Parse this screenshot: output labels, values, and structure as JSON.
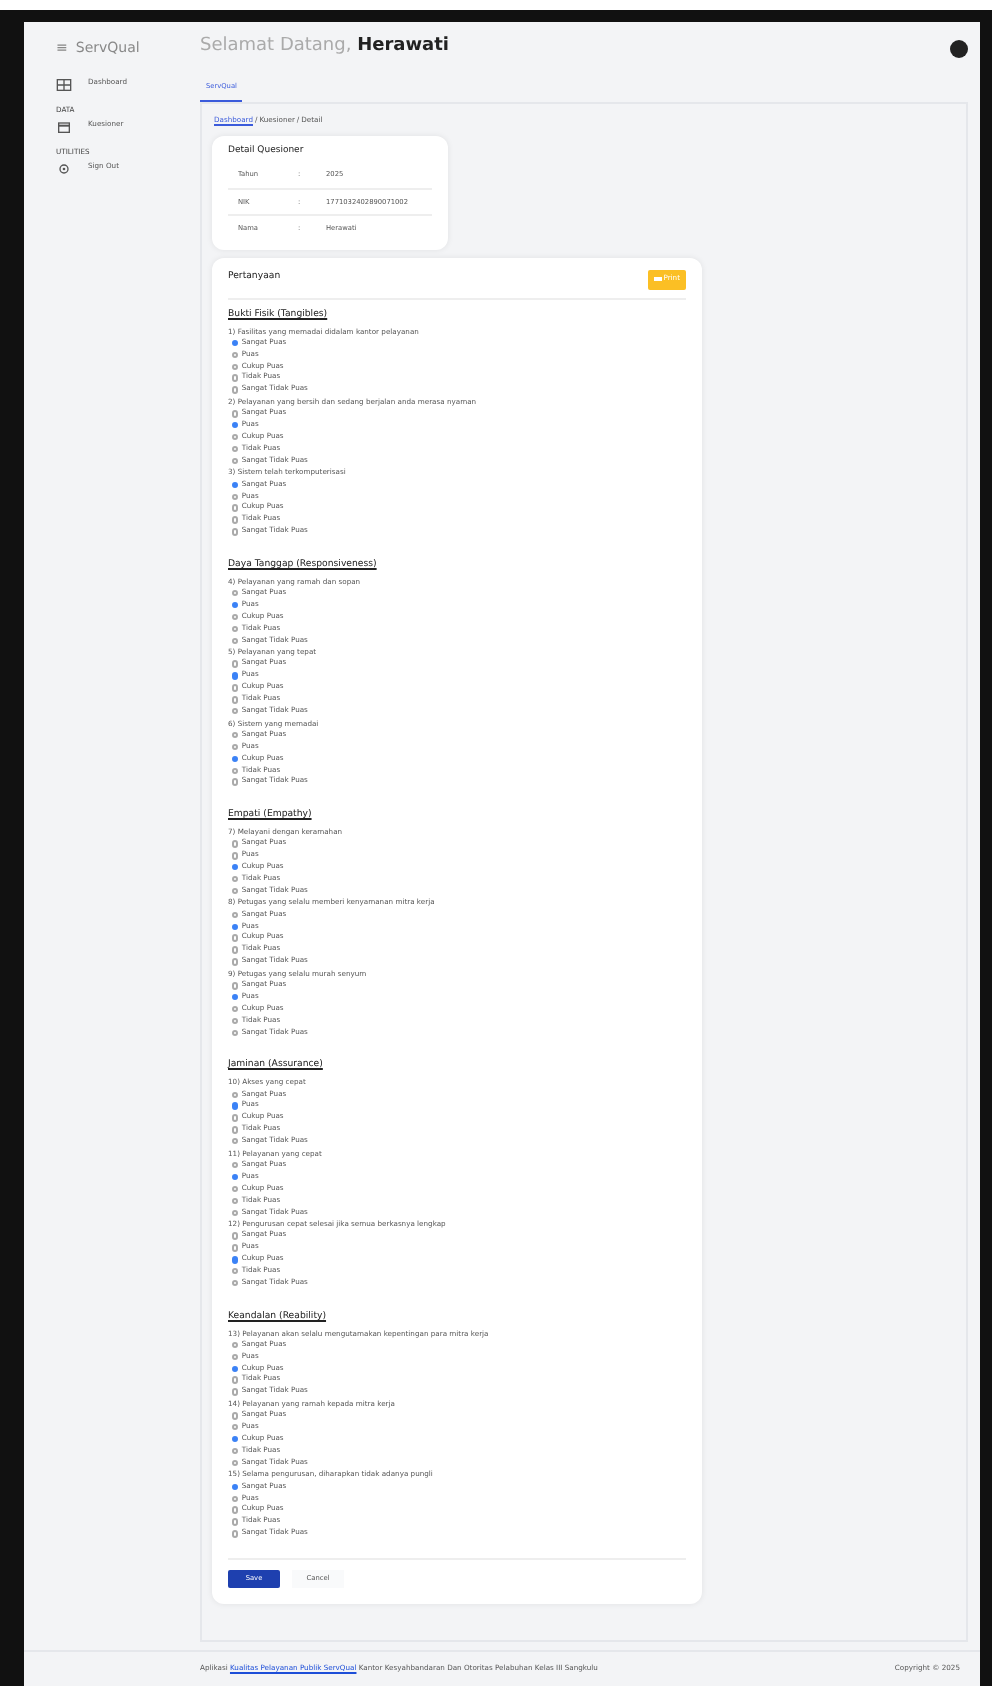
{
  "menu_glyph": "≡",
  "brand": "ServQual",
  "greeting": {
    "text": "Selamat Datang, **Herawati**"
  },
  "sidebar": [
    {
      "kind": "item",
      "label": "Dashboard"
    },
    {
      "kind": "heading",
      "label": "DATA"
    },
    {
      "kind": "item",
      "label": "Kuesioner"
    },
    {
      "kind": "heading",
      "label": "UTILITIES"
    },
    {
      "kind": "item",
      "label": "Sign Out"
    }
  ],
  "tab": {
    "label": "ServQual",
    "selected": true
  },
  "breadcrumb": [
    {
      "label": "Dashboard",
      "link": true
    },
    {
      "separator": "/",
      "label": "Kuesioner",
      "link": false
    },
    {
      "separator": "/",
      "label": "Detail",
      "link": false
    }
  ],
  "detail": {
    "title": "Detail Quesioner",
    "rows": [
      {
        "label": "Tahun",
        "sep": ":",
        "value": "2025"
      },
      {
        "label": "NIK",
        "sep": ":",
        "value": "1771032402890071002"
      },
      {
        "label": "Nama",
        "sep": ":",
        "value": "Herawati"
      }
    ]
  },
  "questions_card": {
    "title": "Pertanyaan",
    "print_button": "Print",
    "sections": [
      {
        "title": "Bukti Fisik (Tangibles)",
        "questions": [
          {
            "text": "1) Fasilitas yang memadai didalam kantor pelayanan",
            "options": [
              {
                "label": "Sangat Puas",
                "selected": true
              },
              {
                "label": "Puas",
                "selected": false
              },
              {
                "label": "Cukup Puas",
                "selected": false
              },
              {
                "label": "Tidak Puas",
                "selected": false
              },
              {
                "label": "Sangat Tidak Puas",
                "selected": false
              }
            ]
          },
          {
            "text": "2) Pelayanan yang bersih dan sedang berjalan anda merasa nyaman",
            "options": [
              {
                "label": "Sangat Puas",
                "selected": false
              },
              {
                "label": "Puas",
                "selected": true
              },
              {
                "label": "Cukup Puas",
                "selected": false
              },
              {
                "label": "Tidak Puas",
                "selected": false
              },
              {
                "label": "Sangat Tidak Puas",
                "selected": false
              }
            ]
          },
          {
            "text": "3) Sistem telah terkomputerisasi",
            "options": [
              {
                "label": "Sangat Puas",
                "selected": true
              },
              {
                "label": "Puas",
                "selected": false
              },
              {
                "label": "Cukup Puas",
                "selected": false
              },
              {
                "label": "Tidak Puas",
                "selected": false
              },
              {
                "label": "Sangat Tidak Puas",
                "selected": false
              }
            ]
          }
        ]
      },
      {
        "title": "Daya Tanggap (Responsiveness)",
        "questions": [
          {
            "text": "4) Pelayanan yang ramah dan sopan",
            "options": [
              {
                "label": "Sangat Puas",
                "selected": false
              },
              {
                "label": "Puas",
                "selected": true
              },
              {
                "label": "Cukup Puas",
                "selected": false
              },
              {
                "label": "Tidak Puas",
                "selected": false
              },
              {
                "label": "Sangat Tidak Puas",
                "selected": false
              }
            ]
          },
          {
            "text": "5) Pelayanan yang tepat",
            "options": [
              {
                "label": "Sangat Puas",
                "selected": false
              },
              {
                "label": "Puas",
                "selected": true
              },
              {
                "label": "Cukup Puas",
                "selected": false
              },
              {
                "label": "Tidak Puas",
                "selected": false
              },
              {
                "label": "Sangat Tidak Puas",
                "selected": false
              }
            ]
          },
          {
            "text": "6) Sistem yang memadai",
            "options": [
              {
                "label": "Sangat Puas",
                "selected": false
              },
              {
                "label": "Puas",
                "selected": false
              },
              {
                "label": "Cukup Puas",
                "selected": true
              },
              {
                "label": "Tidak Puas",
                "selected": false
              },
              {
                "label": "Sangat Tidak Puas",
                "selected": false
              }
            ]
          }
        ]
      },
      {
        "title": "Empati (Empathy)",
        "questions": [
          {
            "text": "7) Melayani dengan keramahan",
            "options": [
              {
                "label": "Sangat Puas",
                "selected": false
              },
              {
                "label": "Puas",
                "selected": false
              },
              {
                "label": "Cukup Puas",
                "selected": true
              },
              {
                "label": "Tidak Puas",
                "selected": false
              },
              {
                "label": "Sangat Tidak Puas",
                "selected": false
              }
            ]
          },
          {
            "text": "8) Petugas yang selalu memberi kenyamanan mitra kerja",
            "options": [
              {
                "label": "Sangat Puas",
                "selected": false
              },
              {
                "label": "Puas",
                "selected": true
              },
              {
                "label": "Cukup Puas",
                "selected": false
              },
              {
                "label": "Tidak Puas",
                "selected": false
              },
              {
                "label": "Sangat Tidak Puas",
                "selected": false
              }
            ]
          },
          {
            "text": "9) Petugas yang selalu murah senyum",
            "options": [
              {
                "label": "Sangat Puas",
                "selected": false
              },
              {
                "label": "Puas",
                "selected": true
              },
              {
                "label": "Cukup Puas",
                "selected": false
              },
              {
                "label": "Tidak Puas",
                "selected": false
              },
              {
                "label": "Sangat Tidak Puas",
                "selected": false
              }
            ]
          }
        ]
      },
      {
        "title": "Jaminan (Assurance)",
        "questions": [
          {
            "text": "10) Akses yang cepat",
            "options": [
              {
                "label": "Sangat Puas",
                "selected": false
              },
              {
                "label": "Puas",
                "selected": true
              },
              {
                "label": "Cukup Puas",
                "selected": false
              },
              {
                "label": "Tidak Puas",
                "selected": false
              },
              {
                "label": "Sangat Tidak Puas",
                "selected": false
              }
            ]
          },
          {
            "text": "11) Pelayanan yang cepat",
            "options": [
              {
                "label": "Sangat Puas",
                "selected": false
              },
              {
                "label": "Puas",
                "selected": true
              },
              {
                "label": "Cukup Puas",
                "selected": false
              },
              {
                "label": "Tidak Puas",
                "selected": false
              },
              {
                "label": "Sangat Tidak Puas",
                "selected": false
              }
            ]
          },
          {
            "text": "12) Pengurusan cepat selesai jika semua berkasnya lengkap",
            "options": [
              {
                "label": "Sangat Puas",
                "selected": false
              },
              {
                "label": "Puas",
                "selected": false
              },
              {
                "label": "Cukup Puas",
                "selected": true
              },
              {
                "label": "Tidak Puas",
                "selected": false
              },
              {
                "label": "Sangat Tidak Puas",
                "selected": false
              }
            ]
          }
        ]
      },
      {
        "title": "Keandalan (Reability)",
        "questions": [
          {
            "text": "13) Pelayanan akan selalu mengutamakan kepentingan para mitra kerja",
            "options": [
              {
                "label": "Sangat Puas",
                "selected": false
              },
              {
                "label": "Puas",
                "selected": false
              },
              {
                "label": "Cukup Puas",
                "selected": true
              },
              {
                "label": "Tidak Puas",
                "selected": false
              },
              {
                "label": "Sangat Tidak Puas",
                "selected": false
              }
            ]
          },
          {
            "text": "14) Pelayanan yang ramah kepada mitra kerja",
            "options": [
              {
                "label": "Sangat Puas",
                "selected": false
              },
              {
                "label": "Puas",
                "selected": false
              },
              {
                "label": "Cukup Puas",
                "selected": true
              },
              {
                "label": "Tidak Puas",
                "selected": false
              },
              {
                "label": "Sangat Tidak Puas",
                "selected": false
              }
            ]
          },
          {
            "text": "15) Selama pengurusan, diharapkan tidak adanya pungli",
            "options": [
              {
                "label": "Sangat Puas",
                "selected": true
              },
              {
                "label": "Puas",
                "selected": false
              },
              {
                "label": "Cukup Puas",
                "selected": false
              },
              {
                "label": "Tidak Puas",
                "selected": false
              },
              {
                "label": "Sangat Tidak Puas",
                "selected": false
              }
            ]
          }
        ]
      }
    ],
    "save_button": "Save",
    "cancel_button": "Cancel"
  },
  "footer": {
    "prefix": "Aplikasi",
    "link": "Kualitas Pelayanan Publik ServQual",
    "suffix": "Kantor Kesyahbandaran Dan Otoritas Pelabuhan Kelas III Sangkulu",
    "copyright": "Copyright © 2025"
  }
}
